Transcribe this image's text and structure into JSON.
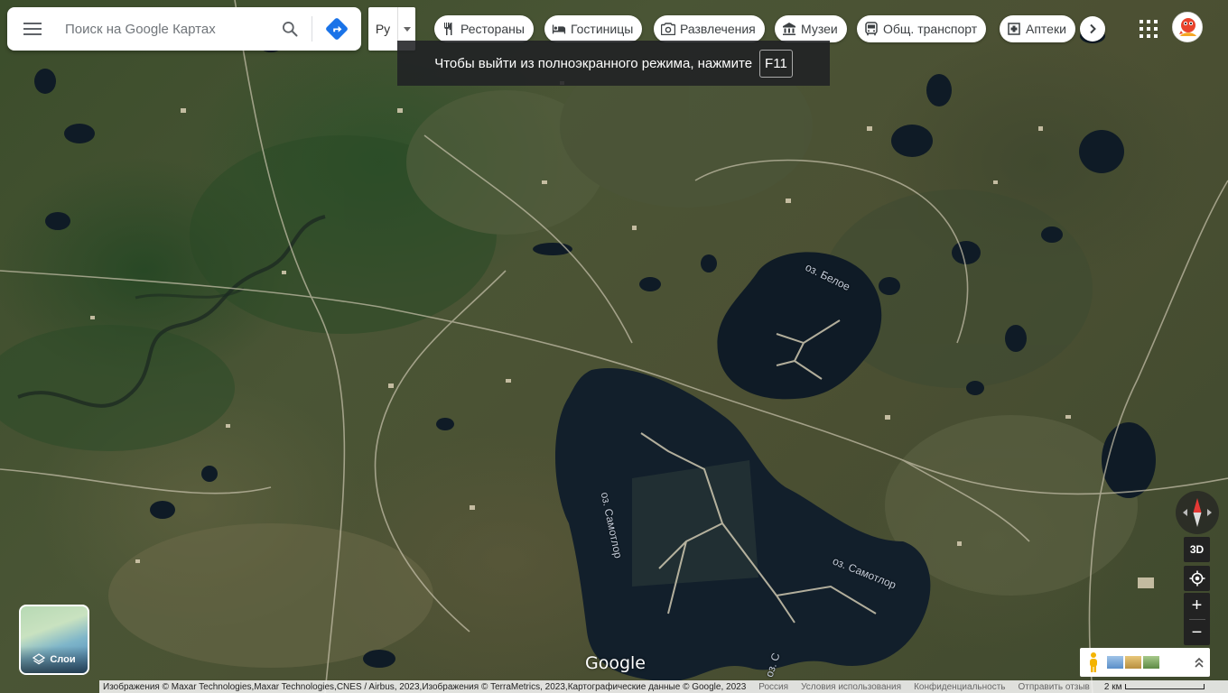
{
  "search": {
    "placeholder": "Поиск на Google Картах"
  },
  "keyboard_layout": {
    "label": "Ру"
  },
  "categories": [
    {
      "label": "Рестораны",
      "icon": "fork-knife-icon"
    },
    {
      "label": "Гостиницы",
      "icon": "bed-icon"
    },
    {
      "label": "Развлечения",
      "icon": "camera-icon"
    },
    {
      "label": "Музеи",
      "icon": "museum-icon"
    },
    {
      "label": "Общ. транспорт",
      "icon": "bus-icon"
    },
    {
      "label": "Аптеки",
      "icon": "pharmacy-icon"
    }
  ],
  "fullscreen_hint": {
    "text": "Чтобы выйти из полноэкранного режима, нажмите",
    "key": "F11"
  },
  "map_labels": {
    "lake_beloe": "оз. Белое",
    "lake_samotlor_v": "оз. Самотлор",
    "lake_samotlor_d": "оз. Самотлор",
    "lake_samotlor_c": "оз. С"
  },
  "controls": {
    "tilt_label": "3D",
    "zoom_in": "+",
    "zoom_out": "−"
  },
  "layers": {
    "label": "Слои"
  },
  "logo": "Google",
  "footer": {
    "attribution": "Изображения © Maxar Technologies,Maxar Technologies,CNES / Airbus, 2023,Изображения © TerraMetrics, 2023,Картографические данные © Google, 2023",
    "country": "Россия",
    "terms": "Условия использования",
    "privacy": "Конфиденциальность",
    "feedback": "Отправить отзыв",
    "scale": "2 км"
  },
  "colors": {
    "directions_blue": "#1a73e8",
    "lake_dark": "#0f1b26"
  }
}
